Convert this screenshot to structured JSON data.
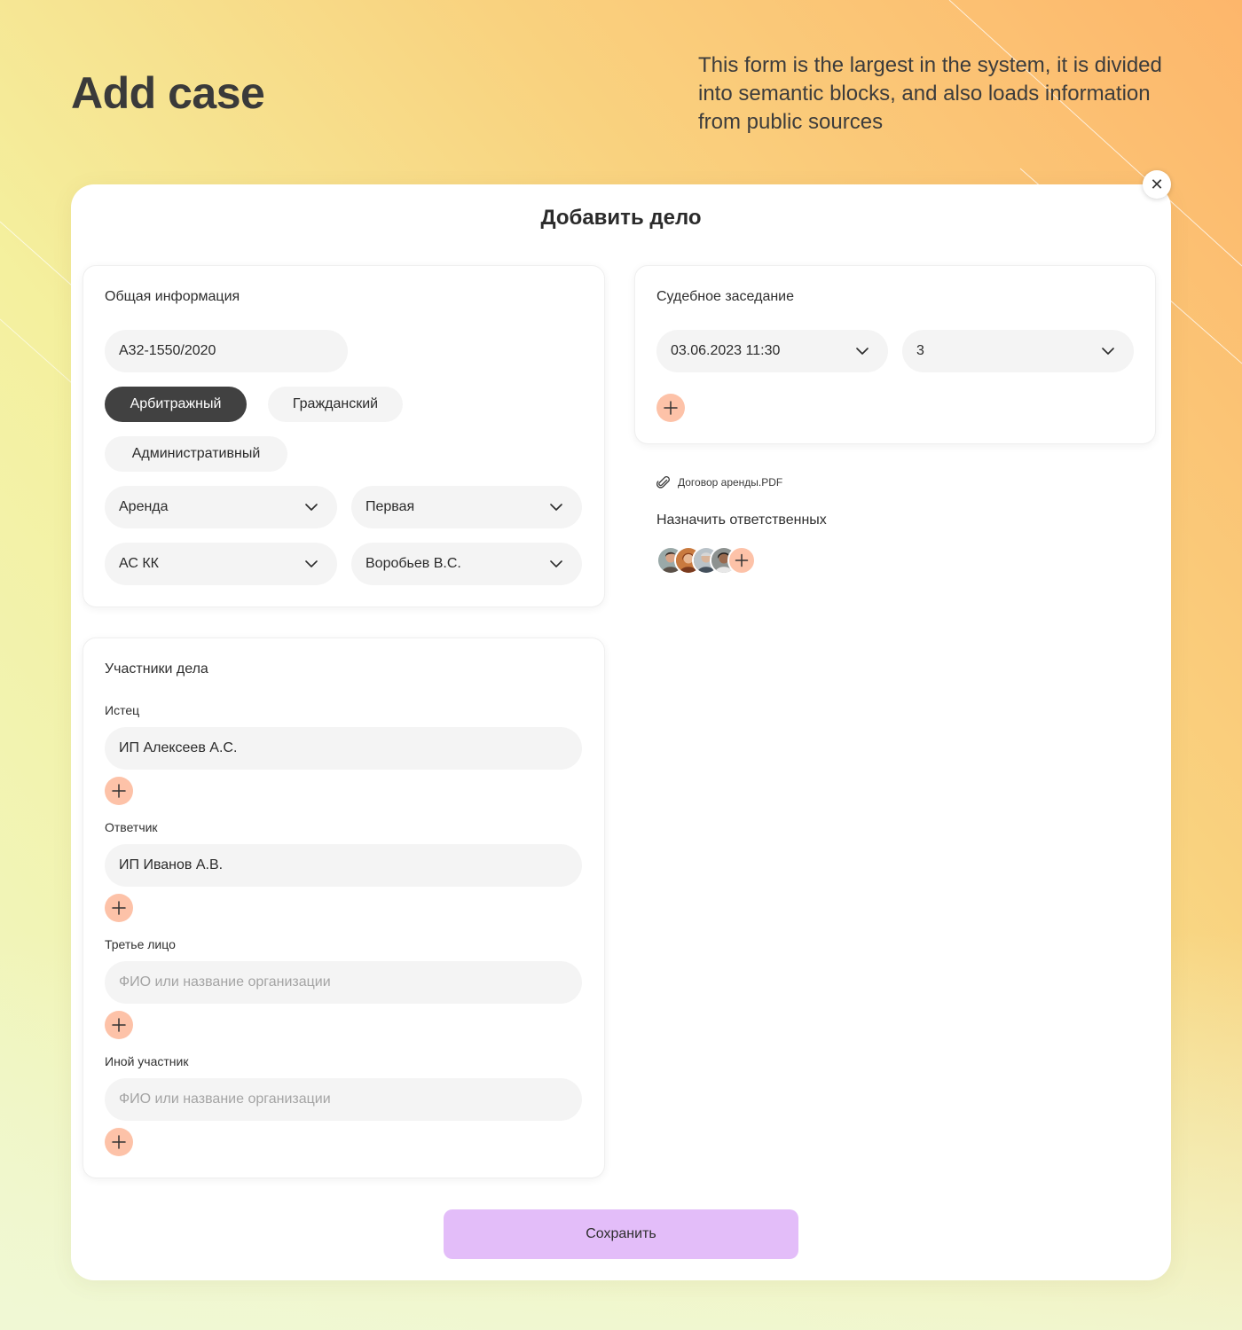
{
  "hero": {
    "title": "Add case",
    "description": "This form is the largest in the system, it is divided into semantic blocks, and also loads information from public sources"
  },
  "modal": {
    "title": "Добавить дело",
    "close_icon": "close-icon",
    "general": {
      "title": "Общая информация",
      "case_number": "А32-1550/2020",
      "case_types": [
        "Арбитражный",
        "Гражданский",
        "Административный"
      ],
      "active_type": "Арбитражный",
      "category": "Аренда",
      "instance": "Первая",
      "court": "АС КК",
      "judge": "Воробьев В.С."
    },
    "hearing": {
      "title": "Судебное заседание",
      "datetime": "03.06.2023 11:30",
      "room": "3"
    },
    "attachment": {
      "icon": "paperclip-icon",
      "filename": "Договор аренды.PDF"
    },
    "assign": {
      "label": "Назначить ответственных",
      "avatar_count": 4
    },
    "participants": {
      "title": "Участники дела",
      "plaintiff_label": "Истец",
      "plaintiff_value": "ИП Алексеев А.С.",
      "defendant_label": "Ответчик",
      "defendant_value": "ИП Иванов А.В.",
      "third_party_label": "Третье лицо",
      "third_party_placeholder": "ФИО или название организации",
      "other_label": "Иной участник",
      "other_placeholder": "ФИО или название организации"
    },
    "save_label": "Сохранить"
  },
  "colors": {
    "accent_plus": "#fdc2a8",
    "save_button": "#e3bdf9",
    "active_pill": "#414141",
    "field_bg": "#f4f4f4"
  }
}
